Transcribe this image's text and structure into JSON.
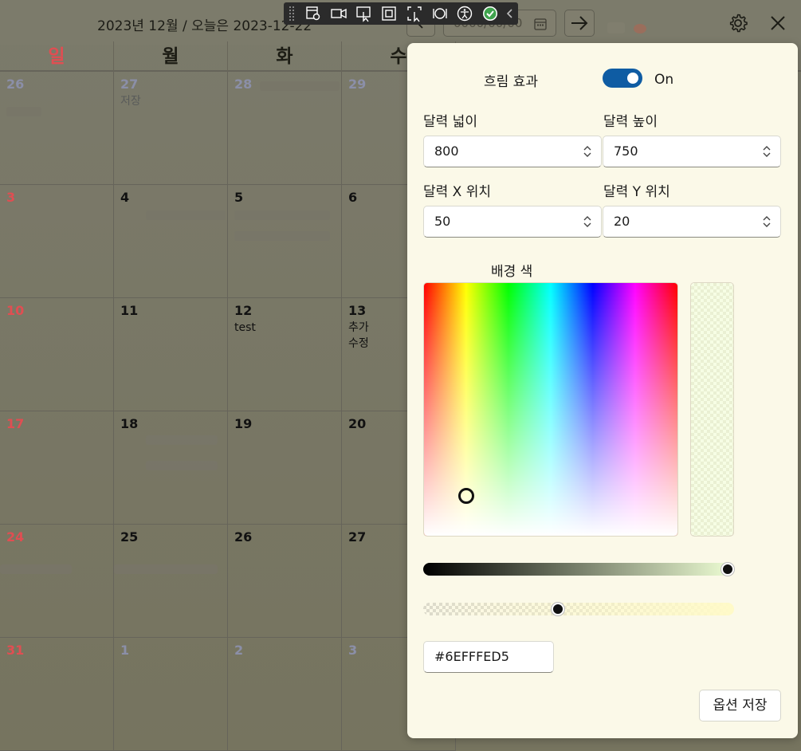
{
  "calendar": {
    "title": "2023년 12월 / 오늘은 2023-12-22",
    "date_input": "0000/00/00",
    "weekdays": [
      "일",
      "월",
      "화",
      "수"
    ],
    "weeks": [
      [
        {
          "num": "26"
        },
        {
          "num": "27",
          "events": [
            "저장"
          ]
        },
        {
          "num": "28"
        },
        {
          "num": "29"
        }
      ],
      [
        {
          "num": "3"
        },
        {
          "num": "4"
        },
        {
          "num": "5"
        },
        {
          "num": "6"
        }
      ],
      [
        {
          "num": "10"
        },
        {
          "num": "11"
        },
        {
          "num": "12",
          "events": [
            "test"
          ]
        },
        {
          "num": "13",
          "events": [
            "추가",
            "수정"
          ]
        }
      ],
      [
        {
          "num": "17"
        },
        {
          "num": "18"
        },
        {
          "num": "19"
        },
        {
          "num": "20"
        }
      ],
      [
        {
          "num": "24"
        },
        {
          "num": "25"
        },
        {
          "num": "26"
        },
        {
          "num": "27"
        }
      ],
      [
        {
          "num": "31"
        },
        {
          "num": "1"
        },
        {
          "num": "2"
        },
        {
          "num": "3"
        }
      ]
    ]
  },
  "settings": {
    "blur_label": "흐림 효과",
    "blur_state": "On",
    "width_label": "달력 넓이",
    "width_value": "800",
    "height_label": "달력 높이",
    "height_value": "750",
    "x_label": "달력 X 위치",
    "x_value": "50",
    "y_label": "달력 Y 위치",
    "y_value": "20",
    "bg_color_label": "배경 색",
    "hex_value": "#6EFFFED5",
    "value_slider_level": 1.0,
    "alpha_slider_level": 0.43,
    "save_label": "옵션 저장"
  },
  "colors": {
    "accent": "#0f5ca3",
    "sunday": "#e04e52",
    "panel_bg": "#fbf9e8"
  },
  "toolbar_icons": [
    "capture-settings-icon",
    "video-icon",
    "pointer-select-icon",
    "frame-icon",
    "region-select-icon",
    "sync-icon",
    "accessibility-icon",
    "check-icon",
    "chevron-left-icon"
  ]
}
